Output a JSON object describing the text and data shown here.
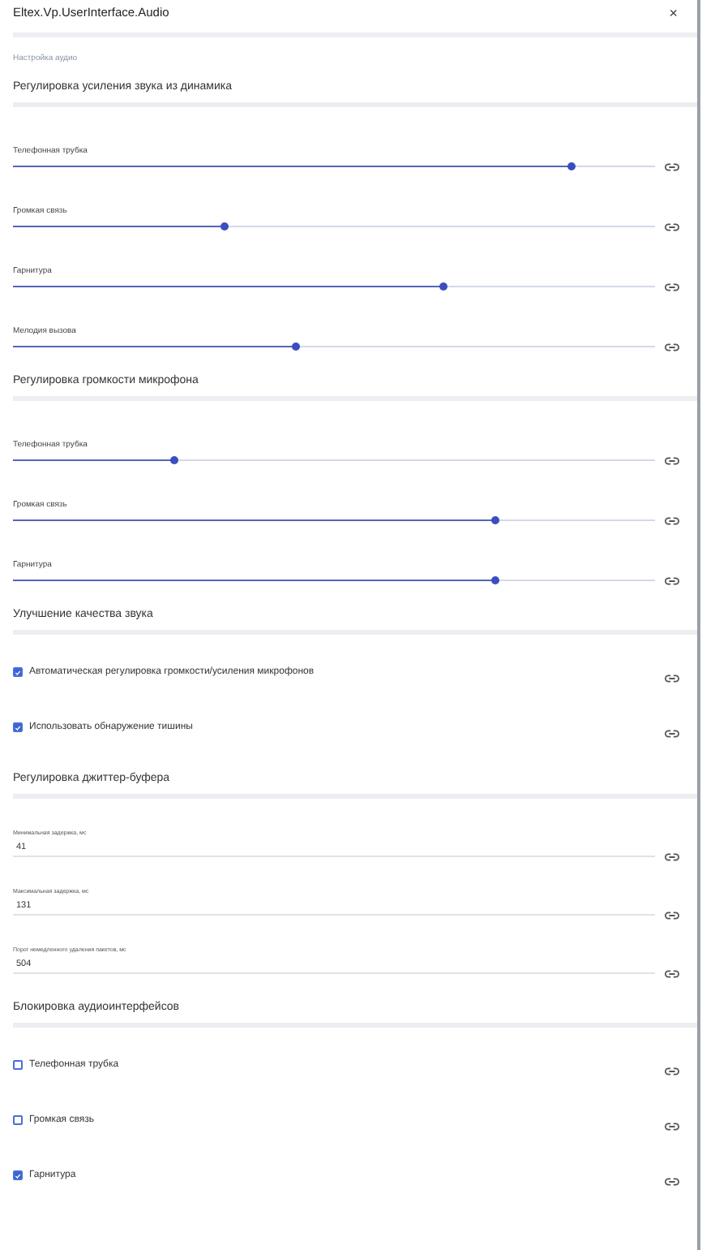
{
  "window": {
    "title": "Eltex.Vp.UserInterface.Audio",
    "close": "×"
  },
  "subtitle": "Настройка аудио",
  "sections": [
    {
      "heading": "Регулировка усиления звука из динамика",
      "items": [
        {
          "kind": "slider",
          "label": "Телефонная трубка",
          "level": 0.87
        },
        {
          "kind": "slider",
          "label": "Громкая связь",
          "level": 0.33
        },
        {
          "kind": "slider",
          "label": "Гарнитура",
          "level": 0.67
        },
        {
          "kind": "slider",
          "label": "Мелодия вызова",
          "level": 0.44
        }
      ]
    },
    {
      "heading": "Регулировка громкости микрофона",
      "items": [
        {
          "kind": "slider",
          "label": "Телефонная трубка",
          "level": 0.25
        },
        {
          "kind": "slider",
          "label": "Громкая связь",
          "level": 0.75
        },
        {
          "kind": "slider",
          "label": "Гарнитура",
          "level": 0.75
        }
      ]
    },
    {
      "heading": "Улучшение качества звука",
      "items": [
        {
          "kind": "checkbox",
          "label": "Автоматическая регулировка громкости/усиления микрофонов",
          "checked": true
        },
        {
          "kind": "checkbox",
          "label": "Использовать обнаружение тишины",
          "checked": true
        }
      ]
    },
    {
      "heading": "Регулировка джиттер-буфера",
      "items": [
        {
          "kind": "field",
          "label": "Минимальная задержка, мс",
          "value": "41"
        },
        {
          "kind": "field",
          "label": "Максимальная задержка, мс",
          "value": "131"
        },
        {
          "kind": "field",
          "label": "Порог немедленного удаления пакетов, мс",
          "value": "504"
        }
      ]
    },
    {
      "heading": "Блокировка аудиоинтерфейсов",
      "items": [
        {
          "kind": "checkbox",
          "label": "Телефонная трубка",
          "checked": false
        },
        {
          "kind": "checkbox",
          "label": "Громкая связь",
          "checked": false
        },
        {
          "kind": "checkbox",
          "label": "Гарнитура",
          "checked": true
        }
      ]
    }
  ]
}
